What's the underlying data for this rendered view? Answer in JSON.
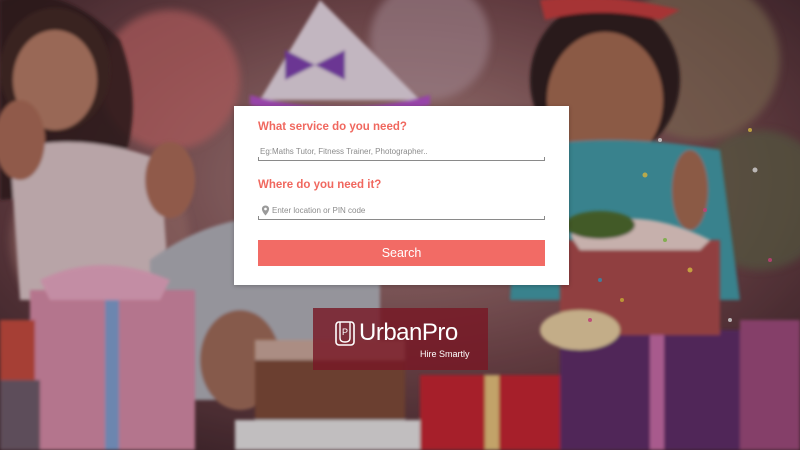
{
  "search_form": {
    "service_label": "What service do you need?",
    "service_placeholder": "Eg:Maths Tutor, Fitness Trainer, Photographer..",
    "location_label": "Where do you need it?",
    "location_placeholder": "Enter location or PIN code",
    "search_button_label": "Search"
  },
  "brand": {
    "logo_letter": "P",
    "name": "UrbanPro",
    "tagline": "Hire Smartly"
  },
  "colors": {
    "accent": "#f26b65",
    "label": "#f0685f",
    "brand_bg": "#7a1826"
  },
  "icons": {
    "location": "map-pin-icon",
    "logo": "urbanpro-logo-icon"
  }
}
